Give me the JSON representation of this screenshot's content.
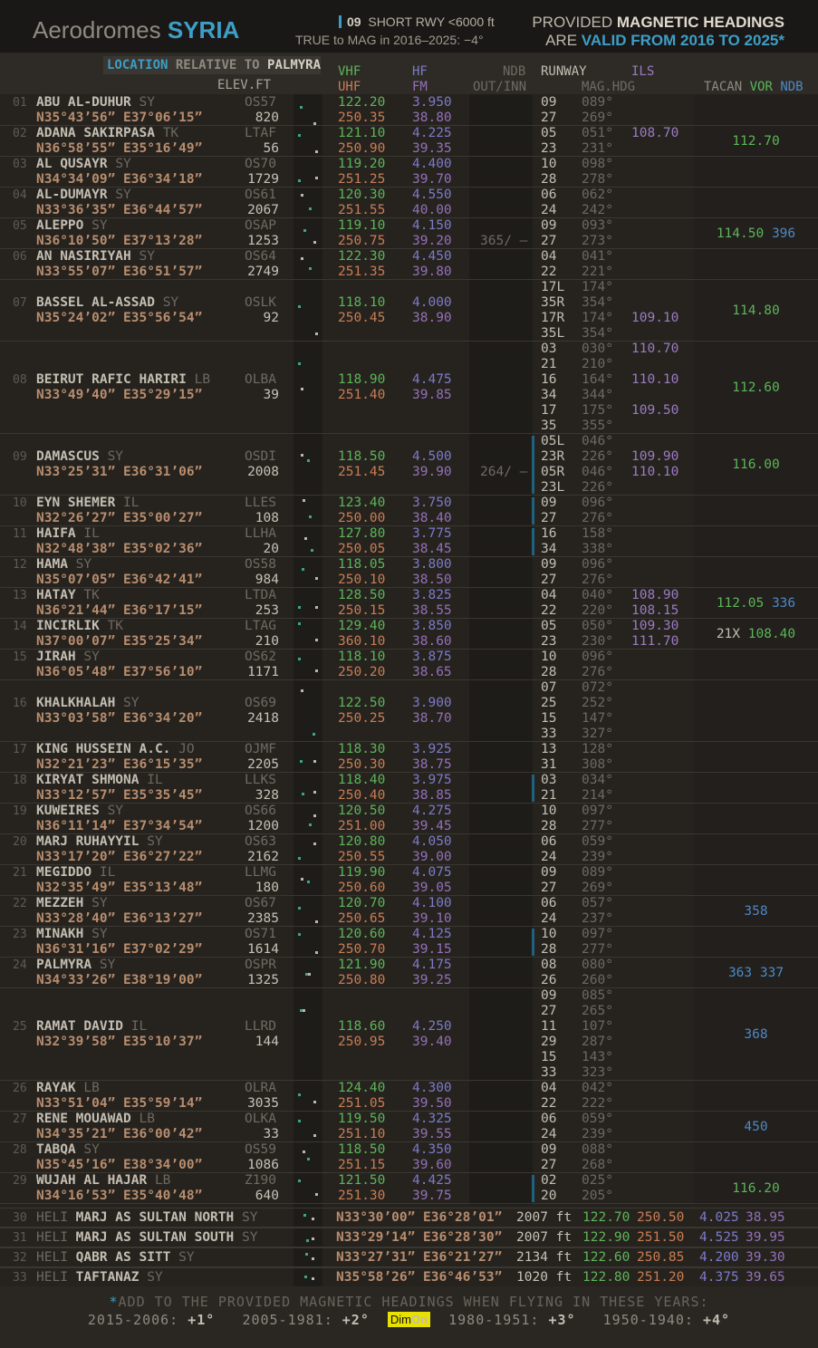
{
  "header": {
    "title_prefix": "Aerodromes",
    "title_country": "SYRIA",
    "short_rwy_num": "09",
    "short_rwy_text": "SHORT RWY <6000 ft",
    "true_to_mag": "TRUE to MAG in 2016–2025:  −4°",
    "right_line1_a": "PROVIDED ",
    "right_line1_b": "MAGNETIC HEADINGS",
    "right_line2_a": "ARE ",
    "right_line2_b": "VALID FROM 2016 TO 2025*"
  },
  "columns": {
    "location": "LOCATION",
    "relative_to": "RELATIVE TO",
    "palmyra": "PALMYRA",
    "elev": "ELEV.FT",
    "vhf": "VHF",
    "uhf": "UHF",
    "hf": "HF",
    "fm": "FM",
    "ndb": "NDB",
    "out_inn": "OUT/INN",
    "runway": "RUNWAY",
    "ils": "ILS",
    "mag_hdg": "MAG.HDG",
    "tacan": "TACAN",
    "vor": "VOR",
    "ndb2": "NDB"
  },
  "colors": {
    "accent": "#3d9ec6",
    "vhf": "#5cb558",
    "uhf": "#c97d52",
    "hf": "#7d7ac9",
    "fm": "#9470b8",
    "coord": "#b88d6e"
  },
  "aerodromes": [
    {
      "idx": "01",
      "name": "ABU AL-DUHUR",
      "cty": "SY",
      "coord": "N35°43’56”  E37°06’15”",
      "icao": "OS57",
      "elev": "820",
      "vhf": "122.20",
      "uhf": "250.35",
      "hf": "3.950",
      "fm": "38.80",
      "ndbio": "",
      "rwys": [
        [
          "09",
          "089°"
        ],
        [
          "27",
          "269°"
        ]
      ],
      "ils": [],
      "tacan": "",
      "vor": "",
      "ndb": ""
    },
    {
      "idx": "02",
      "name": "ADANA SAKIRPASA",
      "cty": "TK",
      "coord": "N36°58’55”  E35°16’49”",
      "icao": "LTAF",
      "elev": "56",
      "vhf": "121.10",
      "uhf": "250.90",
      "hf": "4.225",
      "fm": "39.35",
      "ndbio": "",
      "rwys": [
        [
          "05",
          "051°"
        ],
        [
          "23",
          "231°"
        ]
      ],
      "ils": [
        "108.70"
      ],
      "tacan": "",
      "vor": "112.70",
      "ndb": ""
    },
    {
      "idx": "03",
      "name": "AL QUSAYR",
      "cty": "SY",
      "coord": "N34°34’09”  E36°34’18”",
      "icao": "OS70",
      "elev": "1729",
      "vhf": "119.20",
      "uhf": "251.25",
      "hf": "4.400",
      "fm": "39.70",
      "ndbio": "",
      "rwys": [
        [
          "10",
          "098°"
        ],
        [
          "28",
          "278°"
        ]
      ],
      "ils": [],
      "tacan": "",
      "vor": "",
      "ndb": ""
    },
    {
      "idx": "04",
      "name": "AL-DUMAYR",
      "cty": "SY",
      "coord": "N33°36’35”  E36°44’57”",
      "icao": "OS61",
      "elev": "2067",
      "vhf": "120.30",
      "uhf": "251.55",
      "hf": "4.550",
      "fm": "40.00",
      "ndbio": "",
      "rwys": [
        [
          "06",
          "062°"
        ],
        [
          "24",
          "242°"
        ]
      ],
      "ils": [],
      "tacan": "",
      "vor": "",
      "ndb": ""
    },
    {
      "idx": "05",
      "name": "ALEPPO",
      "cty": "SY",
      "coord": "N36°10’50”  E37°13’28”",
      "icao": "OSAP",
      "elev": "1253",
      "vhf": "119.10",
      "uhf": "250.75",
      "hf": "4.150",
      "fm": "39.20",
      "ndbio": "365/ –",
      "rwys": [
        [
          "09",
          "093°"
        ],
        [
          "27",
          "273°"
        ]
      ],
      "ils": [],
      "tacan": "",
      "vor": "114.50",
      "ndb": "396"
    },
    {
      "idx": "06",
      "name": "AN NASIRIYAH",
      "cty": "SY",
      "coord": "N33°55’07”  E36°51’57”",
      "icao": "OS64",
      "elev": "2749",
      "vhf": "122.30",
      "uhf": "251.35",
      "hf": "4.450",
      "fm": "39.80",
      "ndbio": "",
      "rwys": [
        [
          "04",
          "041°"
        ],
        [
          "22",
          "221°"
        ]
      ],
      "ils": [],
      "tacan": "",
      "vor": "",
      "ndb": ""
    },
    {
      "idx": "07",
      "name": "BASSEL AL-ASSAD",
      "cty": "SY",
      "coord": "N35°24’02”  E35°56’54”",
      "icao": "OSLK",
      "elev": "92",
      "vhf": "118.10",
      "uhf": "250.45",
      "hf": "4.000",
      "fm": "38.90",
      "ndbio": "",
      "rwys": [
        [
          "17L",
          "174°"
        ],
        [
          "35R",
          "354°"
        ],
        [
          "17R",
          "174°"
        ],
        [
          "35L",
          "354°"
        ]
      ],
      "ils": [
        "",
        "",
        "109.10",
        ""
      ],
      "tacan": "",
      "vor": "114.80",
      "ndb": ""
    },
    {
      "idx": "08",
      "name": "BEIRUT RAFIC HARIRI",
      "cty": "LB",
      "coord": "N33°49’40”  E35°29’15”",
      "icao": "OLBA",
      "elev": "39",
      "vhf": "118.90",
      "uhf": "251.40",
      "hf": "4.475",
      "fm": "39.85",
      "ndbio": "",
      "rwys": [
        [
          "03",
          "030°"
        ],
        [
          "21",
          "210°"
        ],
        [
          "16",
          "164°"
        ],
        [
          "34",
          "344°"
        ],
        [
          "17",
          "175°"
        ],
        [
          "35",
          "355°"
        ]
      ],
      "ils": [
        "110.70",
        "",
        "110.10",
        "",
        "109.50",
        ""
      ],
      "tacan": "",
      "vor": "112.60",
      "ndb": ""
    },
    {
      "idx": "09",
      "name": "DAMASCUS",
      "cty": "SY",
      "coord": "N33°25’31”  E36°31’06”",
      "icao": "OSDI",
      "elev": "2008",
      "vhf": "118.50",
      "uhf": "251.45",
      "hf": "4.500",
      "fm": "39.90",
      "ndbio": "264/ –",
      "rwys": [
        [
          "05L",
          "046°"
        ],
        [
          "23R",
          "226°"
        ],
        [
          "05R",
          "046°"
        ],
        [
          "23L",
          "226°"
        ]
      ],
      "ils": [
        "",
        "109.90",
        "110.10",
        ""
      ],
      "tacan": "",
      "vor": "116.00",
      "ndb": ""
    },
    {
      "idx": "10",
      "name": "EYN SHEMER",
      "cty": "IL",
      "coord": "N32°26’27”  E35°00’27”",
      "icao": "LLES",
      "elev": "108",
      "vhf": "123.40",
      "uhf": "250.00",
      "hf": "3.750",
      "fm": "38.40",
      "ndbio": "",
      "rwys": [
        [
          "09",
          "096°"
        ],
        [
          "27",
          "276°"
        ]
      ],
      "ils": [],
      "tacan": "",
      "vor": "",
      "ndb": ""
    },
    {
      "idx": "11",
      "name": "HAIFA",
      "cty": "IL",
      "coord": "N32°48’38”  E35°02’36”",
      "icao": "LLHA",
      "elev": "20",
      "vhf": "127.80",
      "uhf": "250.05",
      "hf": "3.775",
      "fm": "38.45",
      "ndbio": "",
      "rwys": [
        [
          "16",
          "158°"
        ],
        [
          "34",
          "338°"
        ]
      ],
      "ils": [],
      "tacan": "",
      "vor": "",
      "ndb": ""
    },
    {
      "idx": "12",
      "name": "HAMA",
      "cty": "SY",
      "coord": "N35°07’05”  E36°42’41”",
      "icao": "OS58",
      "elev": "984",
      "vhf": "118.05",
      "uhf": "250.10",
      "hf": "3.800",
      "fm": "38.50",
      "ndbio": "",
      "rwys": [
        [
          "09",
          "096°"
        ],
        [
          "27",
          "276°"
        ]
      ],
      "ils": [],
      "tacan": "",
      "vor": "",
      "ndb": ""
    },
    {
      "idx": "13",
      "name": "HATAY",
      "cty": "TK",
      "coord": "N36°21’44”  E36°17’15”",
      "icao": "LTDA",
      "elev": "253",
      "vhf": "128.50",
      "uhf": "250.15",
      "hf": "3.825",
      "fm": "38.55",
      "ndbio": "",
      "rwys": [
        [
          "04",
          "040°"
        ],
        [
          "22",
          "220°"
        ]
      ],
      "ils": [
        "108.90",
        "108.15"
      ],
      "tacan": "",
      "vor": "112.05",
      "ndb": "336"
    },
    {
      "idx": "14",
      "name": "INCIRLIK",
      "cty": "TK",
      "coord": "N37°00’07”  E35°25’34”",
      "icao": "LTAG",
      "elev": "210",
      "vhf": "129.40",
      "uhf": "360.10",
      "hf": "3.850",
      "fm": "38.60",
      "ndbio": "",
      "rwys": [
        [
          "05",
          "050°"
        ],
        [
          "23",
          "230°"
        ]
      ],
      "ils": [
        "109.30",
        "111.70"
      ],
      "tacan": "21X",
      "vor": "108.40",
      "ndb": ""
    },
    {
      "idx": "15",
      "name": "JIRAH",
      "cty": "SY",
      "coord": "N36°05’48”  E37°56’10”",
      "icao": "OS62",
      "elev": "1171",
      "vhf": "118.10",
      "uhf": "250.20",
      "hf": "3.875",
      "fm": "38.65",
      "ndbio": "",
      "rwys": [
        [
          "10",
          "096°"
        ],
        [
          "28",
          "276°"
        ]
      ],
      "ils": [],
      "tacan": "",
      "vor": "",
      "ndb": ""
    },
    {
      "idx": "16",
      "name": "KHALKHALAH",
      "cty": "SY",
      "coord": "N33°03’58”  E36°34’20”",
      "icao": "OS69",
      "elev": "2418",
      "vhf": "122.50",
      "uhf": "250.25",
      "hf": "3.900",
      "fm": "38.70",
      "ndbio": "",
      "rwys": [
        [
          "07",
          "072°"
        ],
        [
          "25",
          "252°"
        ],
        [
          "15",
          "147°"
        ],
        [
          "33",
          "327°"
        ]
      ],
      "ils": [],
      "tacan": "",
      "vor": "",
      "ndb": ""
    },
    {
      "idx": "17",
      "name": "KING HUSSEIN A.C.",
      "cty": "JO",
      "coord": "N32°21’23”  E36°15’35”",
      "icao": "OJMF",
      "elev": "2205",
      "vhf": "118.30",
      "uhf": "250.30",
      "hf": "3.925",
      "fm": "38.75",
      "ndbio": "",
      "rwys": [
        [
          "13",
          "128°"
        ],
        [
          "31",
          "308°"
        ]
      ],
      "ils": [],
      "tacan": "",
      "vor": "",
      "ndb": ""
    },
    {
      "idx": "18",
      "name": "KIRYAT SHMONA",
      "cty": "IL",
      "coord": "N33°12’57”  E35°35’45”",
      "icao": "LLKS",
      "elev": "328",
      "vhf": "118.40",
      "uhf": "250.40",
      "hf": "3.975",
      "fm": "38.85",
      "ndbio": "",
      "rwys": [
        [
          "03",
          "034°"
        ],
        [
          "21",
          "214°"
        ]
      ],
      "ils": [],
      "tacan": "",
      "vor": "",
      "ndb": ""
    },
    {
      "idx": "19",
      "name": "KUWEIRES",
      "cty": "SY",
      "coord": "N36°11’14”  E37°34’54”",
      "icao": "OS66",
      "elev": "1200",
      "vhf": "120.50",
      "uhf": "251.00",
      "hf": "4.275",
      "fm": "39.45",
      "ndbio": "",
      "rwys": [
        [
          "10",
          "097°"
        ],
        [
          "28",
          "277°"
        ]
      ],
      "ils": [],
      "tacan": "",
      "vor": "",
      "ndb": ""
    },
    {
      "idx": "20",
      "name": "MARJ RUHAYYIL",
      "cty": "SY",
      "coord": "N33°17’20”  E36°27’22”",
      "icao": "OS63",
      "elev": "2162",
      "vhf": "120.80",
      "uhf": "250.55",
      "hf": "4.050",
      "fm": "39.00",
      "ndbio": "",
      "rwys": [
        [
          "06",
          "059°"
        ],
        [
          "24",
          "239°"
        ]
      ],
      "ils": [],
      "tacan": "",
      "vor": "",
      "ndb": ""
    },
    {
      "idx": "21",
      "name": "MEGIDDO",
      "cty": "IL",
      "coord": "N32°35’49”  E35°13’48”",
      "icao": "LLMG",
      "elev": "180",
      "vhf": "119.90",
      "uhf": "250.60",
      "hf": "4.075",
      "fm": "39.05",
      "ndbio": "",
      "rwys": [
        [
          "09",
          "089°"
        ],
        [
          "27",
          "269°"
        ]
      ],
      "ils": [],
      "tacan": "",
      "vor": "",
      "ndb": ""
    },
    {
      "idx": "22",
      "name": "MEZZEH",
      "cty": "SY",
      "coord": "N33°28’40”  E36°13’27”",
      "icao": "OS67",
      "elev": "2385",
      "vhf": "120.70",
      "uhf": "250.65",
      "hf": "4.100",
      "fm": "39.10",
      "ndbio": "",
      "rwys": [
        [
          "06",
          "057°"
        ],
        [
          "24",
          "237°"
        ]
      ],
      "ils": [],
      "tacan": "",
      "vor": "",
      "ndb": "358"
    },
    {
      "idx": "23",
      "name": "MINAKH",
      "cty": "SY",
      "coord": "N36°31’16”  E37°02’29”",
      "icao": "OS71",
      "elev": "1614",
      "vhf": "120.60",
      "uhf": "250.70",
      "hf": "4.125",
      "fm": "39.15",
      "ndbio": "",
      "rwys": [
        [
          "10",
          "097°"
        ],
        [
          "28",
          "277°"
        ]
      ],
      "ils": [],
      "tacan": "",
      "vor": "",
      "ndb": ""
    },
    {
      "idx": "24",
      "name": "PALMYRA",
      "cty": "SY",
      "coord": "N34°33’26”  E38°19’00”",
      "icao": "OSPR",
      "elev": "1325",
      "vhf": "121.90",
      "uhf": "250.80",
      "hf": "4.175",
      "fm": "39.25",
      "ndbio": "",
      "rwys": [
        [
          "08",
          "080°"
        ],
        [
          "26",
          "260°"
        ]
      ],
      "ils": [],
      "tacan": "",
      "vor": "",
      "ndb": "363 337"
    },
    {
      "idx": "25",
      "name": "RAMAT DAVID",
      "cty": "IL",
      "coord": "N32°39’58”  E35°10’37”",
      "icao": "LLRD",
      "elev": "144",
      "vhf": "118.60",
      "uhf": "250.95",
      "hf": "4.250",
      "fm": "39.40",
      "ndbio": "",
      "rwys": [
        [
          "09",
          "085°"
        ],
        [
          "27",
          "265°"
        ],
        [
          "11",
          "107°"
        ],
        [
          "29",
          "287°"
        ],
        [
          "15",
          "143°"
        ],
        [
          "33",
          "323°"
        ]
      ],
      "ils": [],
      "tacan": "",
      "vor": "",
      "ndb": "368"
    },
    {
      "idx": "26",
      "name": "RAYAK",
      "cty": "LB",
      "coord": "N33°51’04”  E35°59’14”",
      "icao": "OLRA",
      "elev": "3035",
      "vhf": "124.40",
      "uhf": "251.05",
      "hf": "4.300",
      "fm": "39.50",
      "ndbio": "",
      "rwys": [
        [
          "04",
          "042°"
        ],
        [
          "22",
          "222°"
        ]
      ],
      "ils": [],
      "tacan": "",
      "vor": "",
      "ndb": ""
    },
    {
      "idx": "27",
      "name": "RENE MOUAWAD",
      "cty": "LB",
      "coord": "N34°35’21”  E36°00’42”",
      "icao": "OLKA",
      "elev": "33",
      "vhf": "119.50",
      "uhf": "251.10",
      "hf": "4.325",
      "fm": "39.55",
      "ndbio": "",
      "rwys": [
        [
          "06",
          "059°"
        ],
        [
          "24",
          "239°"
        ]
      ],
      "ils": [],
      "tacan": "",
      "vor": "",
      "ndb": "450"
    },
    {
      "idx": "28",
      "name": "TABQA",
      "cty": "SY",
      "coord": "N35°45’16”  E38°34’00”",
      "icao": "OS59",
      "elev": "1086",
      "vhf": "118.50",
      "uhf": "251.15",
      "hf": "4.350",
      "fm": "39.60",
      "ndbio": "",
      "rwys": [
        [
          "09",
          "088°"
        ],
        [
          "27",
          "268°"
        ]
      ],
      "ils": [],
      "tacan": "",
      "vor": "",
      "ndb": ""
    },
    {
      "idx": "29",
      "name": "WUJAH AL HAJAR",
      "cty": "LB",
      "coord": "N34°16’53”  E35°40’48”",
      "icao": "Z190",
      "elev": "640",
      "vhf": "121.50",
      "uhf": "251.30",
      "hf": "4.425",
      "fm": "39.75",
      "ndbio": "",
      "rwys": [
        [
          "02",
          "025°"
        ],
        [
          "20",
          "205°"
        ]
      ],
      "ils": [],
      "tacan": "",
      "vor": "116.20",
      "ndb": ""
    }
  ],
  "helipads": [
    {
      "idx": "30",
      "prefix": "HELI",
      "name": "MARJ AS SULTAN NORTH",
      "cty": "SY",
      "coord": "N33°30’00”  E36°28’01”",
      "elev": "2007 ft",
      "vhf": "122.70",
      "uhf": "250.50",
      "hf": "4.025",
      "fm": "38.95"
    },
    {
      "idx": "31",
      "prefix": "HELI",
      "name": "MARJ AS SULTAN SOUTH",
      "cty": "SY",
      "coord": "N33°29’14”  E36°28’30”",
      "elev": "2007 ft",
      "vhf": "122.90",
      "uhf": "251.50",
      "hf": "4.525",
      "fm": "39.95"
    },
    {
      "idx": "32",
      "prefix": "HELI",
      "name": "QABR AS SITT",
      "cty": "SY",
      "coord": "N33°27’31”  E36°21’27”",
      "elev": "2134 ft",
      "vhf": "122.60",
      "uhf": "250.85",
      "hf": "4.200",
      "fm": "39.30"
    },
    {
      "idx": "33",
      "prefix": "HELI",
      "name": "TAFTANAZ",
      "cty": "SY",
      "coord": "N35°58’26”  E36°46’53”",
      "elev": "1020 ft",
      "vhf": "122.80",
      "uhf": "251.20",
      "hf": "4.375",
      "fm": "39.65"
    }
  ],
  "footer": {
    "star": "*",
    "line1": "ADD TO THE PROVIDED MAGNETIC HEADINGS WHEN FLYING IN THESE YEARS:",
    "y1": "2015-2006:",
    "v1": "+1°",
    "y2": "2005-1981:",
    "v2": "+2°",
    "y3": "1980-1951:",
    "v3": "+3°",
    "y4": "1950-1940:",
    "v4": "+4°",
    "dim": "Dim",
    "on": "On"
  }
}
